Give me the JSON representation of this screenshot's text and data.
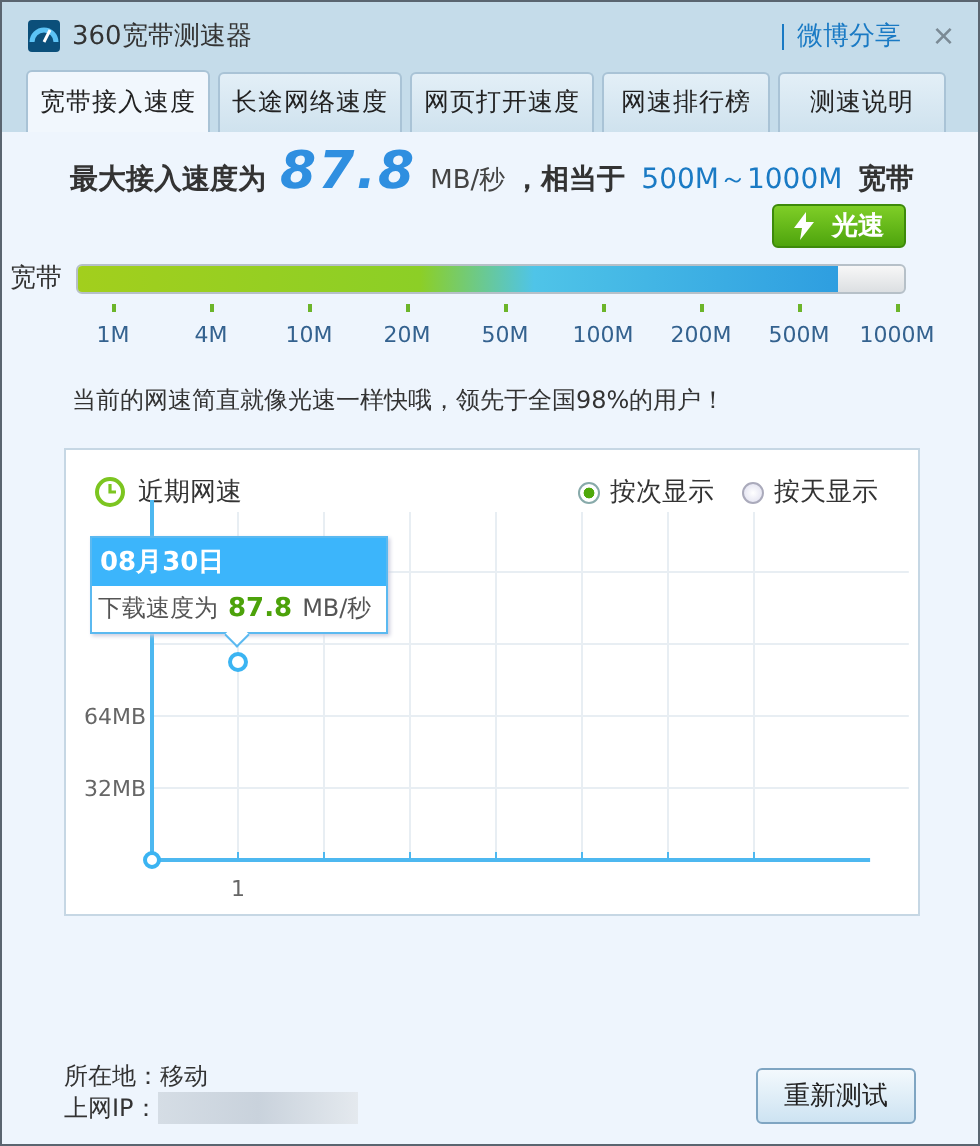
{
  "window": {
    "title": "360宽带测速器",
    "share_link": "微博分享",
    "close": "×"
  },
  "tabs": [
    {
      "label": "宽带接入速度",
      "selected": true
    },
    {
      "label": "长途网络速度",
      "selected": false
    },
    {
      "label": "网页打开速度",
      "selected": false
    },
    {
      "label": "网速排行榜",
      "selected": false
    },
    {
      "label": "测速说明",
      "selected": false
    }
  ],
  "result": {
    "prefix": "最大接入速度为",
    "speed": "87.8",
    "unit": "MB/秒",
    "middle": "，相当于",
    "range": "500M～1000M",
    "suffix": "宽带"
  },
  "speed_bar": {
    "label": "宽带",
    "level": 0.92,
    "badge": "光速",
    "scale": [
      "1M",
      "4M",
      "10M",
      "20M",
      "50M",
      "100M",
      "200M",
      "500M",
      "1000M"
    ]
  },
  "message": "当前的网速简直就像光速一样快哦，领先于全国98%的用户！",
  "history": {
    "title": "近期网速",
    "options": [
      {
        "label": "按次显示",
        "selected": true
      },
      {
        "label": "按天显示",
        "selected": false
      }
    ],
    "chart_data": {
      "type": "line",
      "categories": [
        "1"
      ],
      "series": [
        {
          "color": "#3bb4f2",
          "marker": "circle",
          "values": [
            88
          ]
        }
      ],
      "grid": true,
      "ylim": [
        0,
        160
      ],
      "yticks": [
        {
          "value": 32,
          "label": "32MB"
        },
        {
          "value": 64,
          "label": "64MB"
        }
      ]
    },
    "tooltip": {
      "date": "08月30日",
      "label": "下载速度为",
      "value": "87.8",
      "unit": "MB/秒"
    }
  },
  "footer": {
    "location": "所在地：移动",
    "ip_label": "上网IP：",
    "button": "重新测试"
  }
}
